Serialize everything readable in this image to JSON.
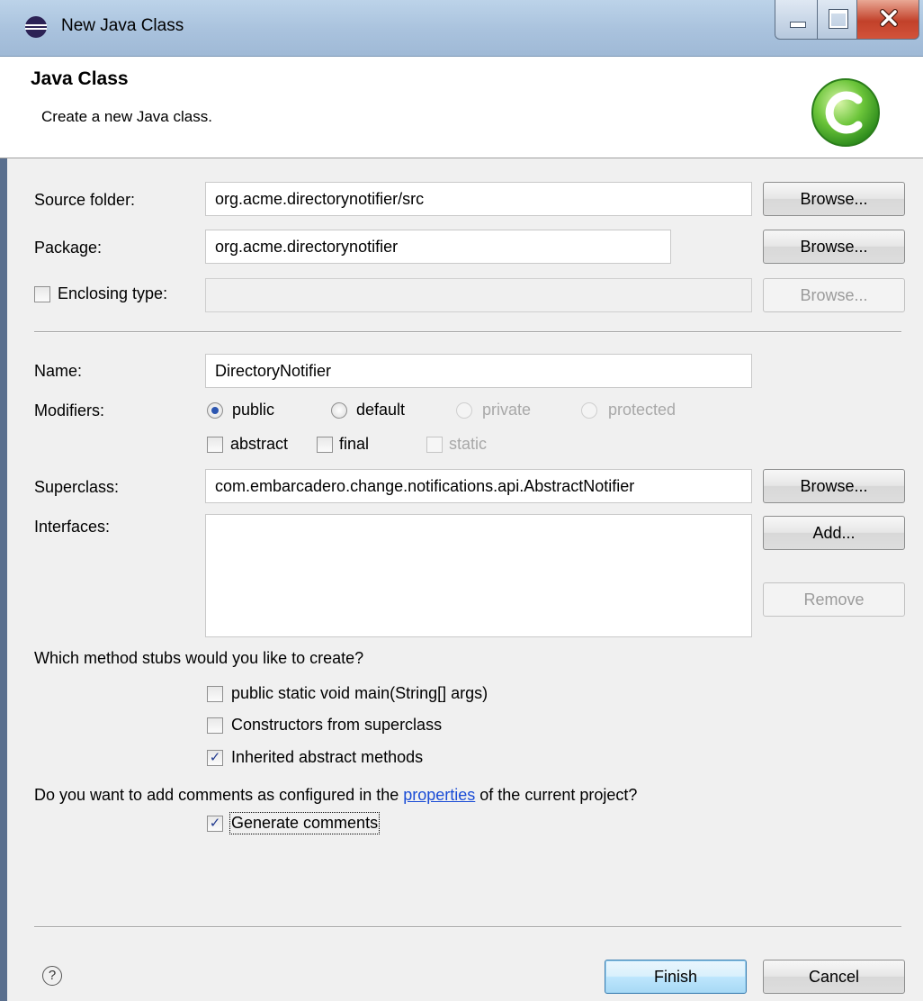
{
  "window": {
    "title": "New Java Class"
  },
  "header": {
    "title": "Java Class",
    "description": "Create a new Java class."
  },
  "form": {
    "source_folder": {
      "label": "Source folder:",
      "value": "org.acme.directorynotifier/src",
      "button": "Browse..."
    },
    "package": {
      "label": "Package:",
      "value": "org.acme.directorynotifier",
      "button": "Browse..."
    },
    "enclosing_type": {
      "label": "Enclosing type:",
      "checked": false,
      "value": "",
      "button": "Browse..."
    },
    "name": {
      "label": "Name:",
      "value": "DirectoryNotifier"
    },
    "modifiers": {
      "label": "Modifiers:",
      "visibility": [
        {
          "label": "public",
          "selected": true,
          "enabled": true
        },
        {
          "label": "default",
          "selected": false,
          "enabled": true
        },
        {
          "label": "private",
          "selected": false,
          "enabled": false
        },
        {
          "label": "protected",
          "selected": false,
          "enabled": false
        }
      ],
      "flags": [
        {
          "label": "abstract",
          "checked": false,
          "enabled": true
        },
        {
          "label": "final",
          "checked": false,
          "enabled": true
        },
        {
          "label": "static",
          "checked": false,
          "enabled": false
        }
      ]
    },
    "superclass": {
      "label": "Superclass:",
      "value": "com.embarcadero.change.notifications.api.AbstractNotifier",
      "button": "Browse..."
    },
    "interfaces": {
      "label": "Interfaces:",
      "items": [],
      "add_button": "Add...",
      "remove_button": "Remove"
    },
    "stubs": {
      "question": "Which method stubs would you like to create?",
      "options": [
        {
          "label": "public static void main(String[] args)",
          "checked": false
        },
        {
          "label": "Constructors from superclass",
          "checked": false
        },
        {
          "label": "Inherited abstract methods",
          "checked": true
        }
      ]
    },
    "comments": {
      "question_before": "Do you want to add comments as configured in the ",
      "question_link": "properties",
      "question_after": " of the current project?",
      "option": {
        "label": "Generate comments",
        "checked": true
      }
    }
  },
  "footer": {
    "help_icon": "?",
    "finish_button": "Finish",
    "cancel_button": "Cancel"
  },
  "colors": {
    "title_bar": "#a9c2dd",
    "dialog_background": "#f0f0f0",
    "header_background": "#ffffff",
    "link": "#1a4cd6",
    "close_button": "#c2412a"
  }
}
